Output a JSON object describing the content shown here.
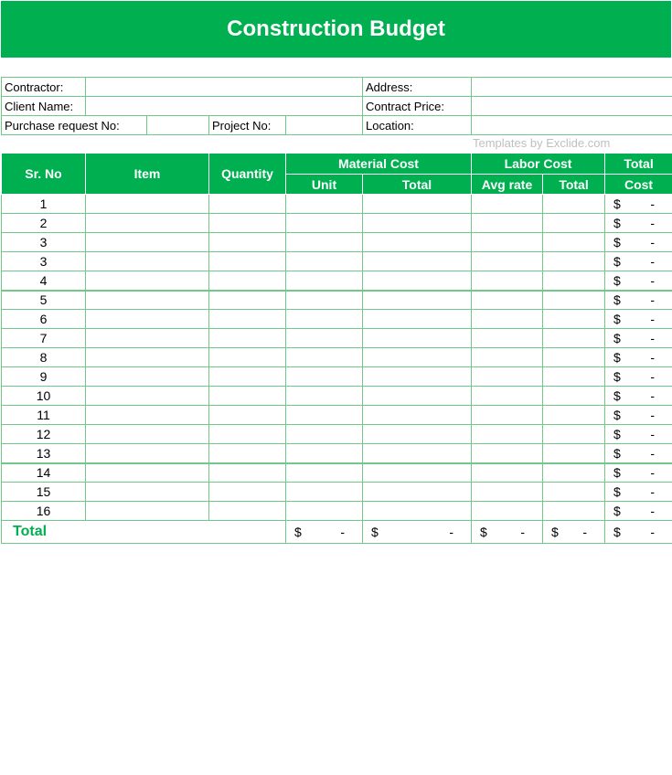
{
  "title": "Construction Budget",
  "info": {
    "contractor_label": "Contractor:",
    "address_label": "Address:",
    "client_label": "Client Name:",
    "contract_price_label": "Contract Price:",
    "purchase_label": "Purchase request No:",
    "project_label": "Project No:",
    "location_label": "Location:"
  },
  "watermark": "Templates by Exclide.com",
  "headers": {
    "sr": "Sr. No",
    "item": "Item",
    "quantity": "Quantity",
    "material_cost": "Material Cost",
    "labor_cost": "Labor Cost",
    "total_cost_1": "Total",
    "total_cost_2": "Cost",
    "unit": "Unit",
    "material_total": "Total",
    "avg_rate": "Avg rate",
    "labor_total": "Total"
  },
  "rows": [
    "1",
    "2",
    "3",
    "3",
    "4",
    "5",
    "6",
    "7",
    "8",
    "9",
    "10",
    "11",
    "12",
    "13",
    "14",
    "15",
    "16"
  ],
  "currency": "$",
  "dash": "-",
  "total_label": "Total"
}
